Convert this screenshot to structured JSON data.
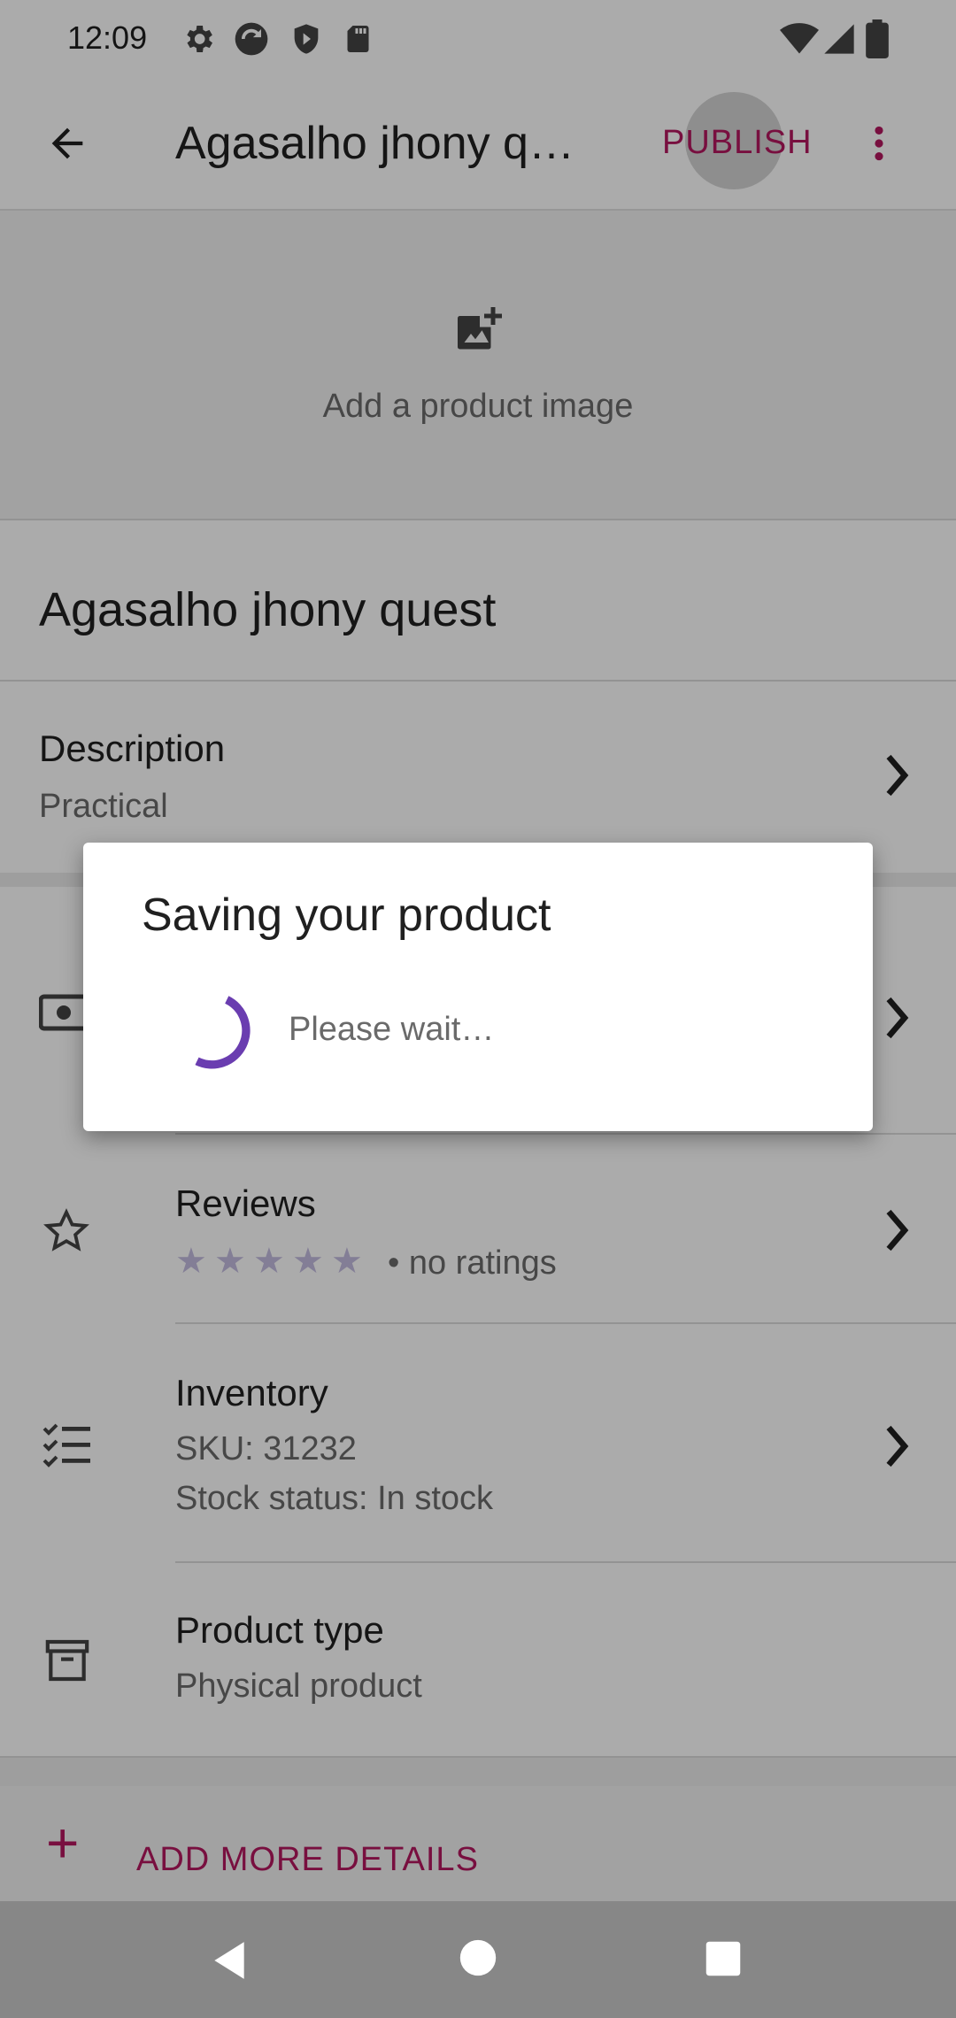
{
  "status_bar": {
    "time": "12:09",
    "icons": [
      "settings-icon",
      "sync-icon",
      "shield-icon",
      "sd-card-icon",
      "wifi-icon",
      "signal-icon",
      "battery-icon"
    ]
  },
  "app_bar": {
    "title": "Agasalho jhony q…",
    "publish_label": "PUBLISH",
    "icons": [
      "back-arrow-icon",
      "more-vert-icon"
    ]
  },
  "image_section": {
    "label": "Add a product image",
    "icon": "add-photo-icon"
  },
  "product": {
    "name": "Agasalho jhony quest"
  },
  "description": {
    "title": "Description",
    "value": "Practical"
  },
  "rows": {
    "reviews": {
      "title": "Reviews",
      "rating_text": "• no ratings",
      "stars": 5,
      "rating": 0
    },
    "inventory": {
      "title": "Inventory",
      "sku": "SKU: 31232",
      "stock": "Stock status: In stock"
    },
    "product_type": {
      "title": "Product type",
      "value": "Physical product"
    }
  },
  "add_more": {
    "label": "ADD MORE DETAILS"
  },
  "dialog": {
    "title": "Saving your product",
    "message": "Please wait…"
  },
  "colors": {
    "accent": "#b3175f",
    "spinner": "#6a3db0",
    "scrim": "#000000"
  }
}
